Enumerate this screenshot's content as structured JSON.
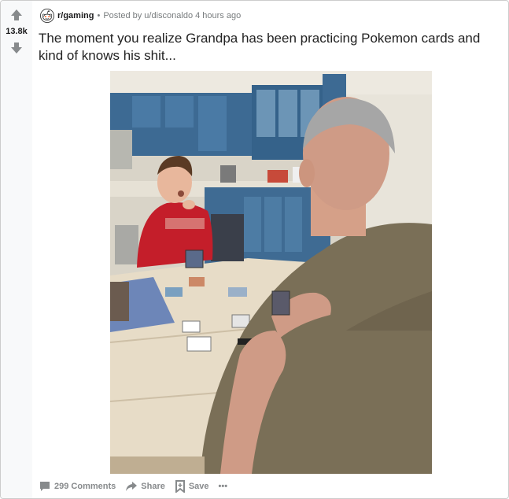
{
  "post": {
    "score": "13.8k",
    "subreddit": "r/gaming",
    "separator": "•",
    "posted_by": "Posted by u/disconaldo 4 hours ago",
    "title": "The moment you realize Grandpa has been practicing Pokemon cards and kind of knows his shit...",
    "image_alt": "Grandpa playing Pokemon cards with grandson at kitchen table"
  },
  "actions": {
    "comments": "299 Comments",
    "share": "Share",
    "save": "Save",
    "more": "•••"
  },
  "icons": {
    "upvote": "upvote-arrow-icon",
    "downvote": "downvote-arrow-icon",
    "subreddit": "subreddit-snoo-icon",
    "comments": "comment-bubble-icon",
    "share": "share-arrow-icon",
    "save": "bookmark-icon",
    "more": "more-dots-icon"
  },
  "colors": {
    "vote_arrow": "#878a8c",
    "text_primary": "#1a1a1b",
    "text_meta": "#787c7e",
    "card_border": "#cccccc",
    "vote_bg": "#f8f9fa"
  }
}
